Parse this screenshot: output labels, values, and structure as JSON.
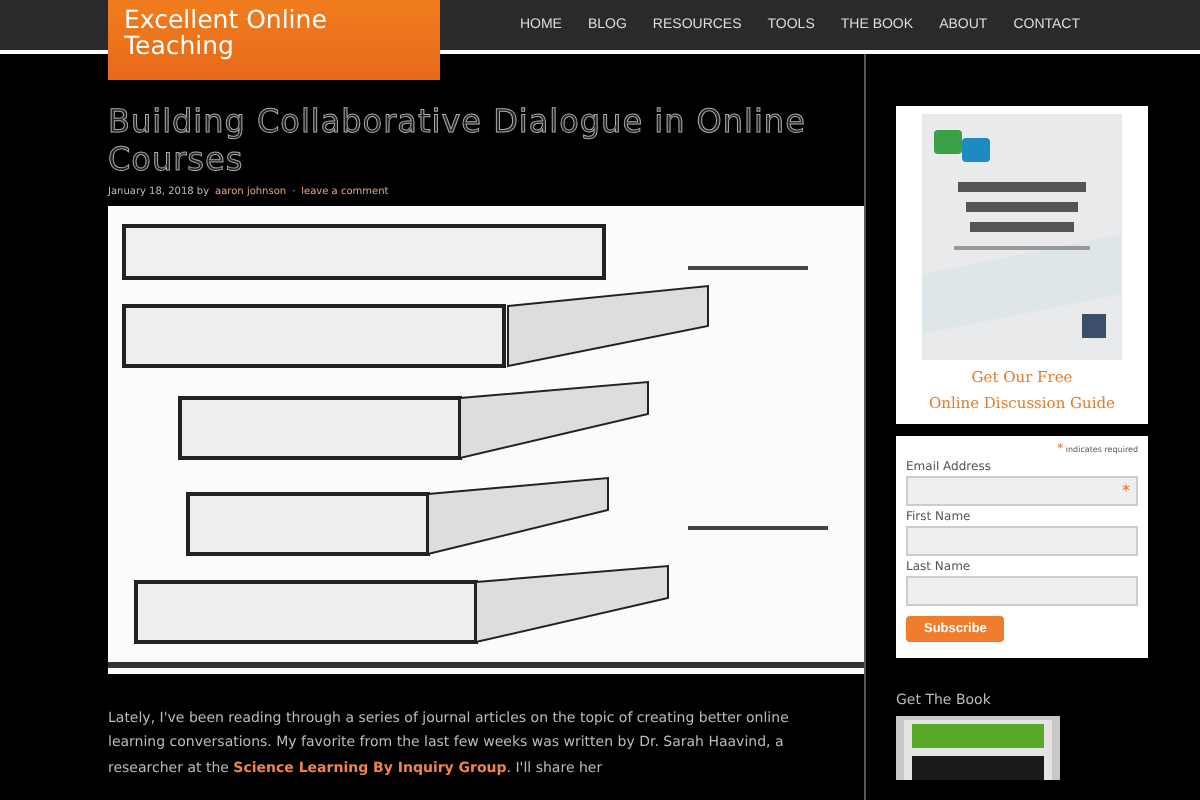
{
  "site_title": "Excellent Online Teaching",
  "nav": [
    {
      "label": "HOME",
      "selected": false
    },
    {
      "label": "BLOG",
      "selected": false
    },
    {
      "label": "RESOURCES",
      "selected": false
    },
    {
      "label": "TOOLS",
      "selected": false
    },
    {
      "label": "THE BOOK",
      "selected": false
    },
    {
      "label": "ABOUT",
      "selected": false
    },
    {
      "label": "CONTACT",
      "selected": false
    }
  ],
  "post": {
    "title": "Building Collaborative Dialogue in Online Courses",
    "date": "January 18, 2018",
    "by": "by",
    "author": "aaron johnson",
    "separator": "·",
    "comments_link": "leave a comment",
    "image": {
      "kind": "picture"
    },
    "paragraph": {
      "before": "Lately, I've been reading through a series of journal articles on the topic of creating better online learning conversations. My favorite from the last few weeks was written by Dr. Sarah Haavind, a researcher at the ",
      "link": "Science Learning By Inquiry Group",
      "after": ". I'll share her"
    }
  },
  "sidebar": {
    "guide": {
      "image": {
        "kind": "picture"
      },
      "caption_lines": [
        "Get Our Free",
        "Online Discussion Guide"
      ]
    },
    "signup": {
      "required_note": "indicates required",
      "required_mark": "*",
      "fields": [
        {
          "label": "Email Address",
          "required": true
        },
        {
          "label": "First Name",
          "required": false
        },
        {
          "label": "Last Name",
          "required": false
        }
      ],
      "button": "Subscribe"
    },
    "book": {
      "heading": "Get The Book",
      "image": {
        "kind": "picture"
      }
    }
  }
}
